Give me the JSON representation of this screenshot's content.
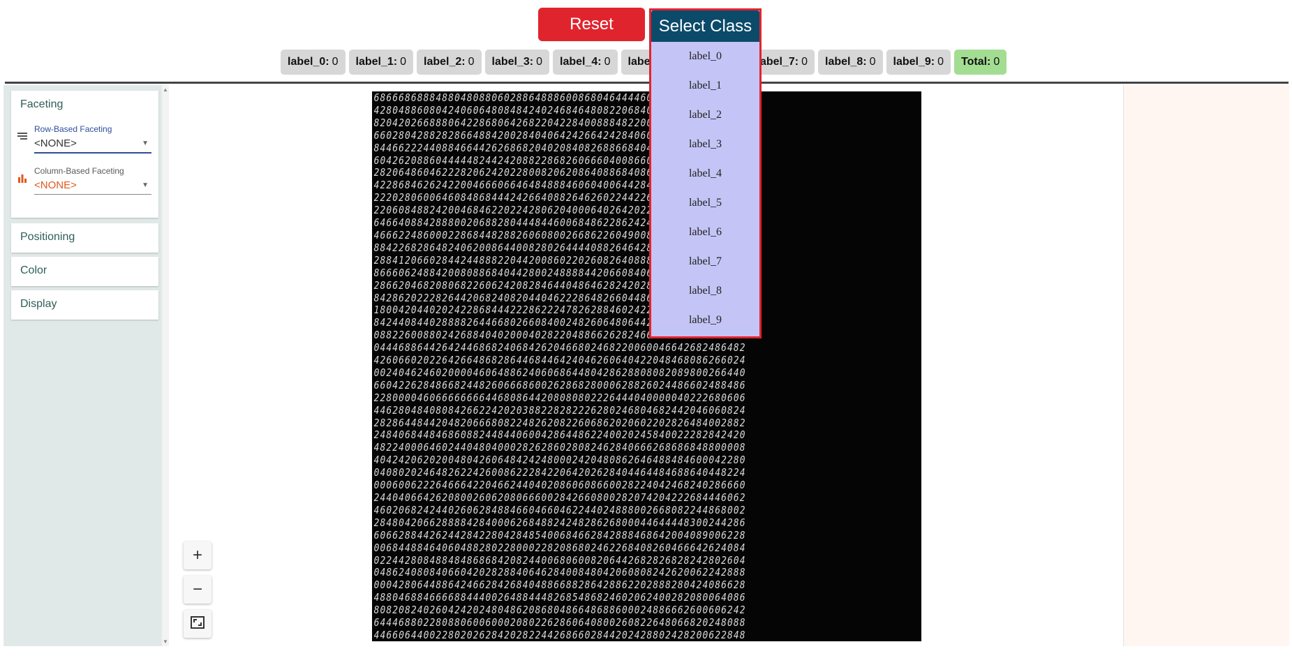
{
  "header": {
    "reset_label": "Reset",
    "select_class_label": "Select Class"
  },
  "label_counts": [
    {
      "label": "label_0:",
      "value": "0"
    },
    {
      "label": "label_1:",
      "value": "0"
    },
    {
      "label": "label_2:",
      "value": "0"
    },
    {
      "label": "label_3:",
      "value": "0"
    },
    {
      "label": "label_4:",
      "value": "0"
    },
    {
      "label": "labe",
      "value": ""
    },
    {
      "label": "label_7:",
      "value": "0"
    },
    {
      "label": "label_8:",
      "value": "0"
    },
    {
      "label": "label_9:",
      "value": "0"
    }
  ],
  "total": {
    "label": "Total:",
    "value": "0"
  },
  "dropdown": {
    "options": [
      "label_0",
      "label_1",
      "label_2",
      "label_3",
      "label_4",
      "label_5",
      "label_6",
      "label_7",
      "label_8",
      "label_9"
    ]
  },
  "sidebar": {
    "faceting": {
      "title": "Faceting",
      "row_label": "Row-Based Faceting",
      "row_value": "<NONE>",
      "col_label": "Column-Based Faceting",
      "col_value": "<NONE>"
    },
    "positioning": "Positioning",
    "color": "Color",
    "display": "Display"
  },
  "zoom": {
    "plus": "+",
    "minus": "−"
  },
  "colors": {
    "reset": "#e0242e",
    "select_header": "#0c4a6a",
    "dropdown_bg": "#c4c4f6",
    "total_chip": "#a3dd92",
    "sidebar_bg": "#e1e9e8"
  },
  "icons": {
    "row_facet": "rows-icon",
    "col_facet": "bar-chart-icon",
    "fit": "fit-screen-icon"
  }
}
